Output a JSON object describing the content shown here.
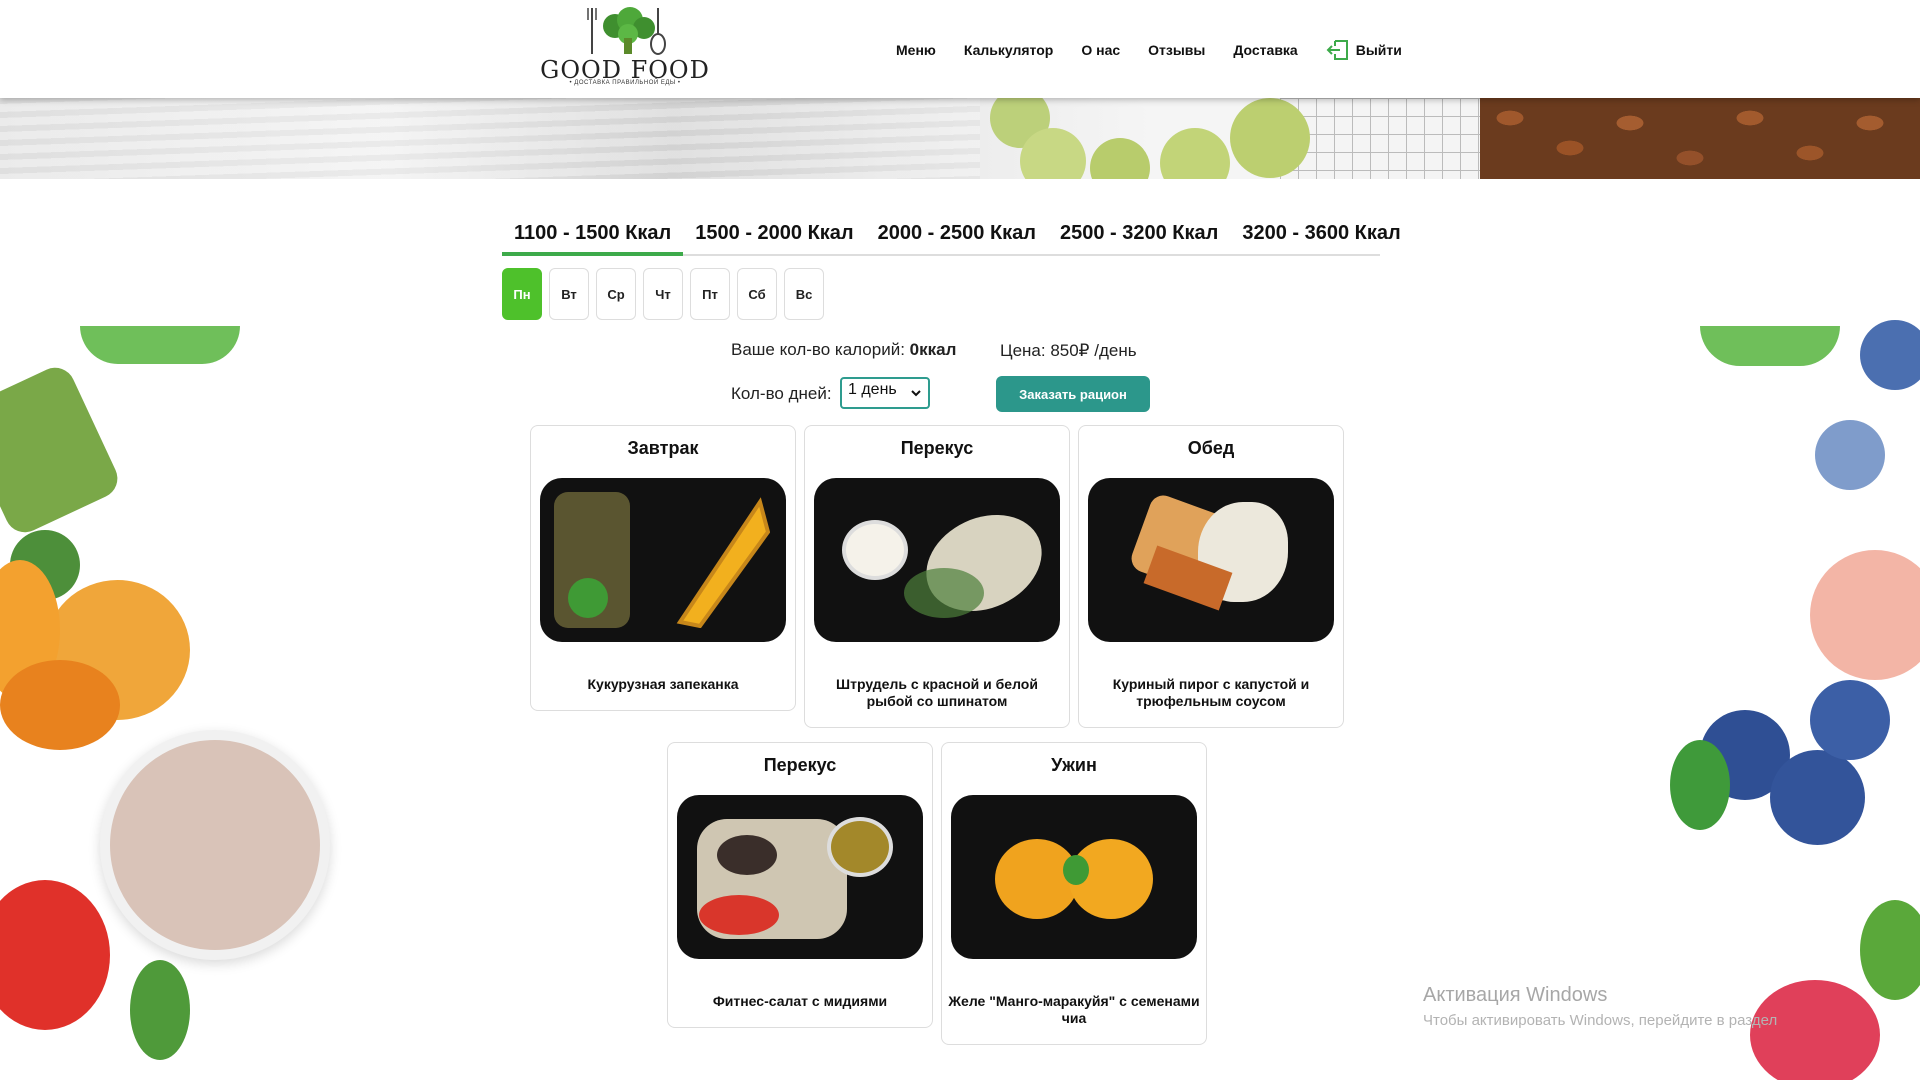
{
  "header": {
    "logo_text": "GOOD FOOD",
    "logo_subtitle": "• ДОСТАВКА ПРАВИЛЬНОЙ ЕДЫ •",
    "nav": [
      "Меню",
      "Калькулятор",
      "О нас",
      "Отзывы",
      "Доставка"
    ],
    "logout_label": "Выйти",
    "logout_icon": "logout-icon"
  },
  "tabs": [
    "1100 - 1500 Ккал",
    "1500 - 2000 Ккал",
    "2000 - 2500 Ккал",
    "2500 - 3200 Ккал",
    "3200 - 3600 Ккал"
  ],
  "active_tab": 0,
  "days": [
    "Пн",
    "Вт",
    "Ср",
    "Чт",
    "Пт",
    "Сб",
    "Вс"
  ],
  "active_day": 0,
  "calories": {
    "label": "Ваше кол-во калорий:",
    "value": "0ккал"
  },
  "price": {
    "label": "Цена: 850₽ /день"
  },
  "days_count": {
    "label": "Кол-во дней:",
    "selected": "1 день"
  },
  "order_button": "Заказать рацион",
  "meals": [
    {
      "title": "Завтрак",
      "name": "Кукурузная запеканка"
    },
    {
      "title": "Перекус",
      "name": "Штрудель с красной и белой рыбой со шпинатом"
    },
    {
      "title": "Обед",
      "name": "Куриный пирог с капустой и трюфельным соусом"
    },
    {
      "title": "Перекус",
      "name": "Фитнес-салат с мидиями"
    },
    {
      "title": "Ужин",
      "name": "Желе \"Манго-маракуйя\" с семенами чиа"
    }
  ],
  "watermark": {
    "title": "Активация Windows",
    "subtitle": "Чтобы активировать Windows, перейдите в раздел"
  },
  "colors": {
    "accent_green": "#4ec12b",
    "teal": "#2c978b"
  }
}
